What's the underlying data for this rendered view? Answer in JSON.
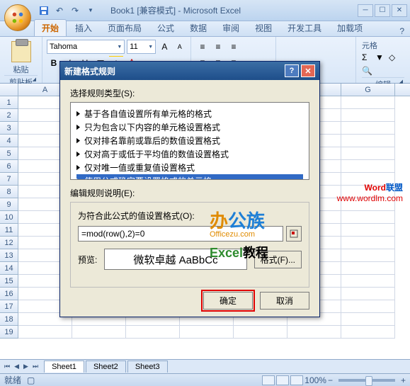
{
  "title_doc": "Book1",
  "title_mode": "[兼容模式]",
  "title_app": "Microsoft Excel",
  "ribbon_tabs": [
    "开始",
    "插入",
    "页面布局",
    "公式",
    "数据",
    "审阅",
    "视图",
    "开发工具",
    "加载项"
  ],
  "font_name": "Tahoma",
  "font_size": "11",
  "group_clipboard": "剪贴板",
  "group_edit": "编辑",
  "paste_label": "粘贴",
  "cell_format_label": "元格",
  "columns": [
    "A",
    "",
    "",
    "",
    "",
    "",
    "G"
  ],
  "row_labels": [
    "1",
    "2",
    "3",
    "4",
    "5",
    "6",
    "7",
    "8",
    "9",
    "10",
    "11",
    "12",
    "13",
    "14",
    "15",
    "16",
    "17",
    "18",
    "19"
  ],
  "sheet_tabs": [
    "Sheet1",
    "Sheet2",
    "Sheet3"
  ],
  "status_ready": "就绪",
  "zoom_pct": "100%",
  "dialog": {
    "title": "新建格式规则",
    "select_type_label": "选择规则类型(S):",
    "rules": [
      "基于各自值设置所有单元格的格式",
      "只为包含以下内容的单元格设置格式",
      "仅对排名靠前或靠后的数值设置格式",
      "仅对高于或低于平均值的数值设置格式",
      "仅对唯一值或重复值设置格式",
      "使用公式确定要设置格式的单元格"
    ],
    "edit_desc_label": "编辑规则说明(E):",
    "formula_label": "为符合此公式的值设置格式(O):",
    "formula_value": "=mod(row(),2)=0",
    "preview_label": "预览:",
    "preview_text": "微软卓越 AaBbCc",
    "format_btn": "格式(F)...",
    "ok": "确定",
    "cancel": "取消"
  },
  "watermark": {
    "brand1a": "Word",
    "brand1b": "联盟",
    "url": "www.wordlm.com"
  },
  "overlay": {
    "l1": "办公族",
    "l2": "Officezu.com",
    "l3a": "Excel",
    "l3b": "教程"
  }
}
